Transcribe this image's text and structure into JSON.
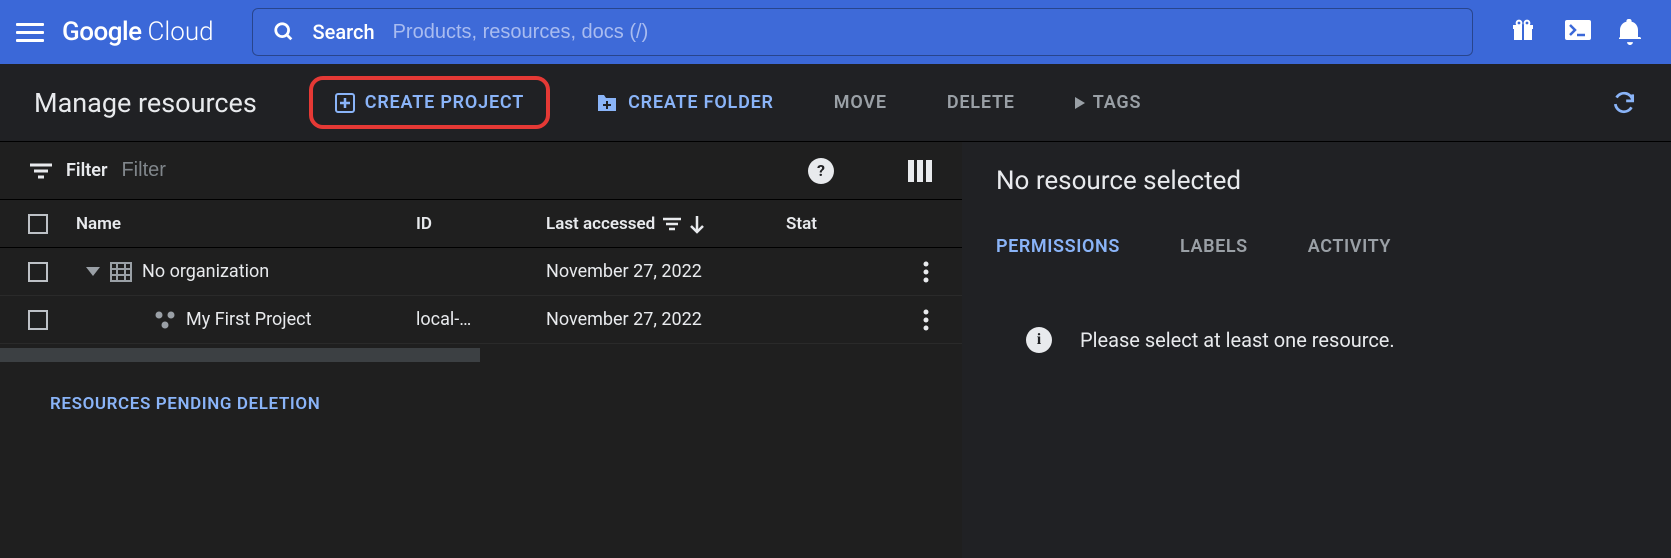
{
  "header": {
    "logo_primary": "Google",
    "logo_secondary": "Cloud",
    "search_label": "Search",
    "search_placeholder": "Products, resources, docs (/)"
  },
  "toolbar": {
    "page_title": "Manage resources",
    "create_project": "CREATE PROJECT",
    "create_folder": "CREATE FOLDER",
    "move": "MOVE",
    "delete": "DELETE",
    "tags": "TAGS"
  },
  "filter": {
    "label": "Filter",
    "placeholder": "Filter"
  },
  "table": {
    "columns": {
      "name": "Name",
      "id": "ID",
      "last_accessed": "Last accessed",
      "status": "Stat"
    },
    "rows": [
      {
        "name": "No organization",
        "id": "",
        "last_accessed": "November 27, 2022"
      },
      {
        "name": "My First Project",
        "id": "local-…",
        "last_accessed": "November 27, 2022"
      }
    ],
    "pending_link": "RESOURCES PENDING DELETION"
  },
  "side": {
    "title": "No resource selected",
    "tabs": {
      "permissions": "PERMISSIONS",
      "labels": "LABELS",
      "activity": "ACTIVITY"
    },
    "message": "Please select at least one resource."
  }
}
